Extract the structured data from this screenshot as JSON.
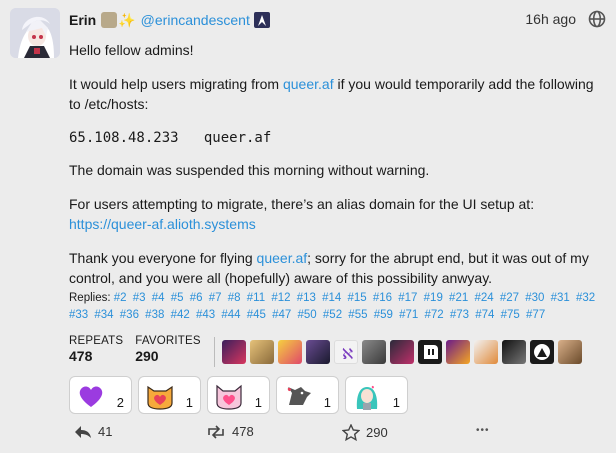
{
  "post": {
    "display_name": "Erin",
    "handle": "@erincandescent",
    "time": "16h ago",
    "content": {
      "p1": "Hello fellow admins!",
      "p2_pre": "It would help users migrating from ",
      "p2_link": "queer.af",
      "p2_post": " if you would temporarily add the following to /etc/hosts:",
      "code": "65.108.48.233   queer.af",
      "p3": "The domain was suspended this morning without warning.",
      "p4_pre": "For users attempting to migrate, there’s an alias domain for the UI setup at: ",
      "p4_link": "https://queer-af.alioth.systems",
      "p5_pre": "Thank you everyone for flying ",
      "p5_link": "queer.af",
      "p5_post": "; sorry for the abrupt end, but it was out of my control, and you were all (hopefully) aware of this possibility anwyay."
    },
    "replies_label": "Replies:",
    "replies": [
      "#2",
      "#3",
      "#4",
      "#5",
      "#6",
      "#7",
      "#8",
      "#11",
      "#12",
      "#13",
      "#14",
      "#15",
      "#16",
      "#17",
      "#19",
      "#21",
      "#24",
      "#27",
      "#30",
      "#31",
      "#32",
      "#33",
      "#34",
      "#36",
      "#38",
      "#42",
      "#43",
      "#44",
      "#45",
      "#47",
      "#50",
      "#52",
      "#55",
      "#59",
      "#71",
      "#72",
      "#73",
      "#74",
      "#75",
      "#77"
    ],
    "repeats_label": "REPEATS",
    "repeats": "478",
    "favorites_label": "FAVORITES",
    "favorites": "290",
    "reactions": [
      {
        "name": "purple-heart",
        "count": "2",
        "color": "#9b3be0"
      },
      {
        "name": "cat-heart",
        "count": "1",
        "color": "#f6a93b"
      },
      {
        "name": "pink-cat-heart",
        "count": "1",
        "color": "#f2a0c8"
      },
      {
        "name": "dragon-heart",
        "count": "1",
        "color": "#555555"
      },
      {
        "name": "miku-heart",
        "count": "1",
        "color": "#39c5bb"
      }
    ],
    "actions": {
      "reply_count": "41",
      "repeat_count": "478",
      "favorite_count": "290",
      "more": "•••"
    }
  },
  "colors": {
    "background": "#ececec",
    "link": "#2b90d9"
  }
}
